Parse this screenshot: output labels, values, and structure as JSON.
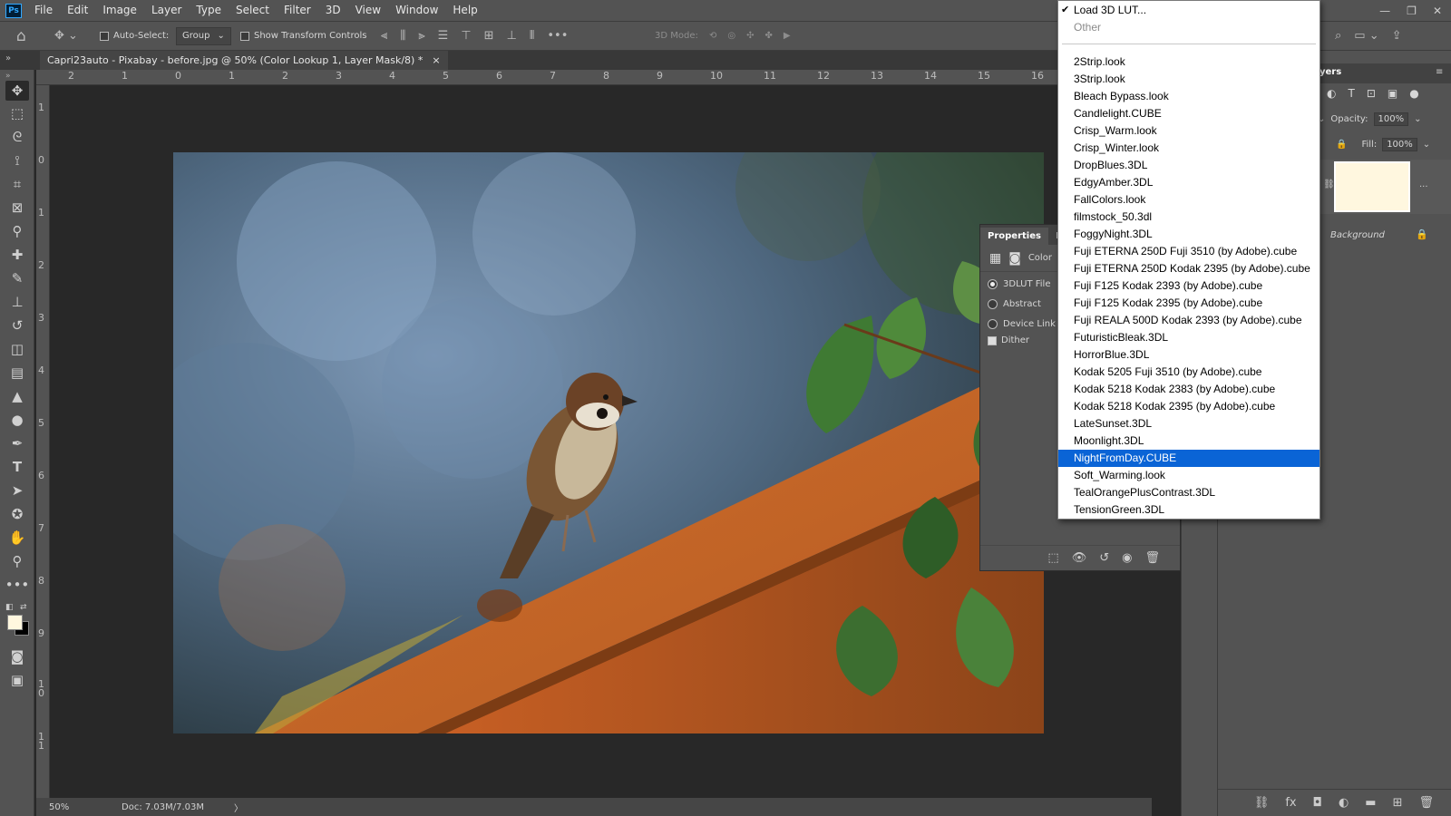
{
  "menubar": {
    "logo": "Ps",
    "items": [
      "File",
      "Edit",
      "Image",
      "Layer",
      "Type",
      "Select",
      "Filter",
      "3D",
      "View",
      "Window",
      "Help"
    ]
  },
  "options_bar": {
    "auto_select_label": "Auto-Select:",
    "auto_select_value": "Group",
    "show_transform_label": "Show Transform Controls",
    "mode_3d_label": "3D Mode:"
  },
  "document_tab": {
    "title": "Capri23auto - Pixabay - before.jpg @ 50% (Color Lookup 1, Layer Mask/8) *",
    "close": "×"
  },
  "ruler_h": [
    "2",
    "1",
    "0",
    "1",
    "2",
    "3",
    "4",
    "5",
    "6",
    "7",
    "8",
    "9",
    "10",
    "11",
    "12",
    "13",
    "14",
    "15",
    "16"
  ],
  "ruler_v": [
    "1",
    "0",
    "1",
    "2",
    "3",
    "4",
    "5",
    "6",
    "7",
    "8",
    "9",
    "1 0",
    "1 1",
    "1 2"
  ],
  "status": {
    "zoom": "50%",
    "doc": "Doc: 7.03M/7.03M",
    "arrow": "〉"
  },
  "properties": {
    "tabs": [
      "Properties",
      "Info"
    ],
    "header_label": "Color",
    "options": [
      {
        "label": "3DLUT File",
        "checked": true
      },
      {
        "label": "Abstract",
        "checked": false
      },
      {
        "label": "Device Link",
        "checked": false
      }
    ],
    "dither_label": "Dither",
    "dither_checked": true
  },
  "layers": {
    "tab_label": "yers",
    "opacity_label": "Opacity:",
    "opacity_value": "100%",
    "fill_label": "Fill:",
    "fill_value": "100%",
    "background_label": "Background",
    "mask_color": "#fff7df"
  },
  "lut_menu": {
    "items": [
      {
        "label": "Load 3D LUT...",
        "checked": true
      },
      {
        "label": "Other",
        "disabled": true
      },
      {
        "label": "2Strip.look"
      },
      {
        "label": "3Strip.look"
      },
      {
        "label": "Bleach Bypass.look"
      },
      {
        "label": "Candlelight.CUBE"
      },
      {
        "label": "Crisp_Warm.look"
      },
      {
        "label": "Crisp_Winter.look"
      },
      {
        "label": "DropBlues.3DL"
      },
      {
        "label": "EdgyAmber.3DL"
      },
      {
        "label": "FallColors.look"
      },
      {
        "label": "filmstock_50.3dl"
      },
      {
        "label": "FoggyNight.3DL"
      },
      {
        "label": "Fuji ETERNA 250D Fuji 3510 (by Adobe).cube"
      },
      {
        "label": "Fuji ETERNA 250D Kodak 2395 (by Adobe).cube"
      },
      {
        "label": "Fuji F125 Kodak 2393 (by Adobe).cube"
      },
      {
        "label": "Fuji F125 Kodak 2395 (by Adobe).cube"
      },
      {
        "label": "Fuji REALA 500D Kodak 2393 (by Adobe).cube"
      },
      {
        "label": "FuturisticBleak.3DL"
      },
      {
        "label": "HorrorBlue.3DL"
      },
      {
        "label": "Kodak 5205 Fuji 3510 (by Adobe).cube"
      },
      {
        "label": "Kodak 5218 Kodak 2383 (by Adobe).cube"
      },
      {
        "label": "Kodak 5218 Kodak 2395 (by Adobe).cube"
      },
      {
        "label": "LateSunset.3DL"
      },
      {
        "label": "Moonlight.3DL"
      },
      {
        "label": "NightFromDay.CUBE",
        "selected": true
      },
      {
        "label": "Soft_Warming.look"
      },
      {
        "label": "TealOrangePlusContrast.3DL"
      },
      {
        "label": "TensionGreen.3DL"
      }
    ],
    "selected_color": "#0a64d6"
  }
}
